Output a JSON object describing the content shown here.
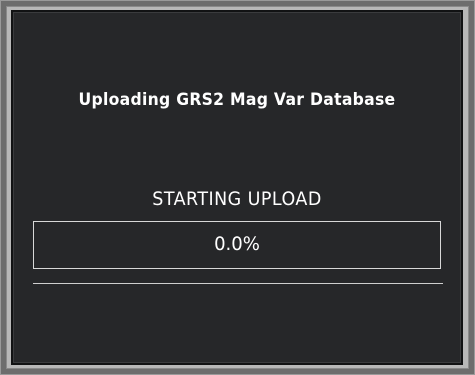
{
  "dialog": {
    "title": "Uploading GRS2 Mag Var Database",
    "status": "STARTING UPLOAD",
    "progress_label": "0.0%",
    "progress_fraction": 0.0
  },
  "colors": {
    "screen_background": "#262729",
    "text": "#ffffff",
    "border": "#d8d8d8"
  }
}
